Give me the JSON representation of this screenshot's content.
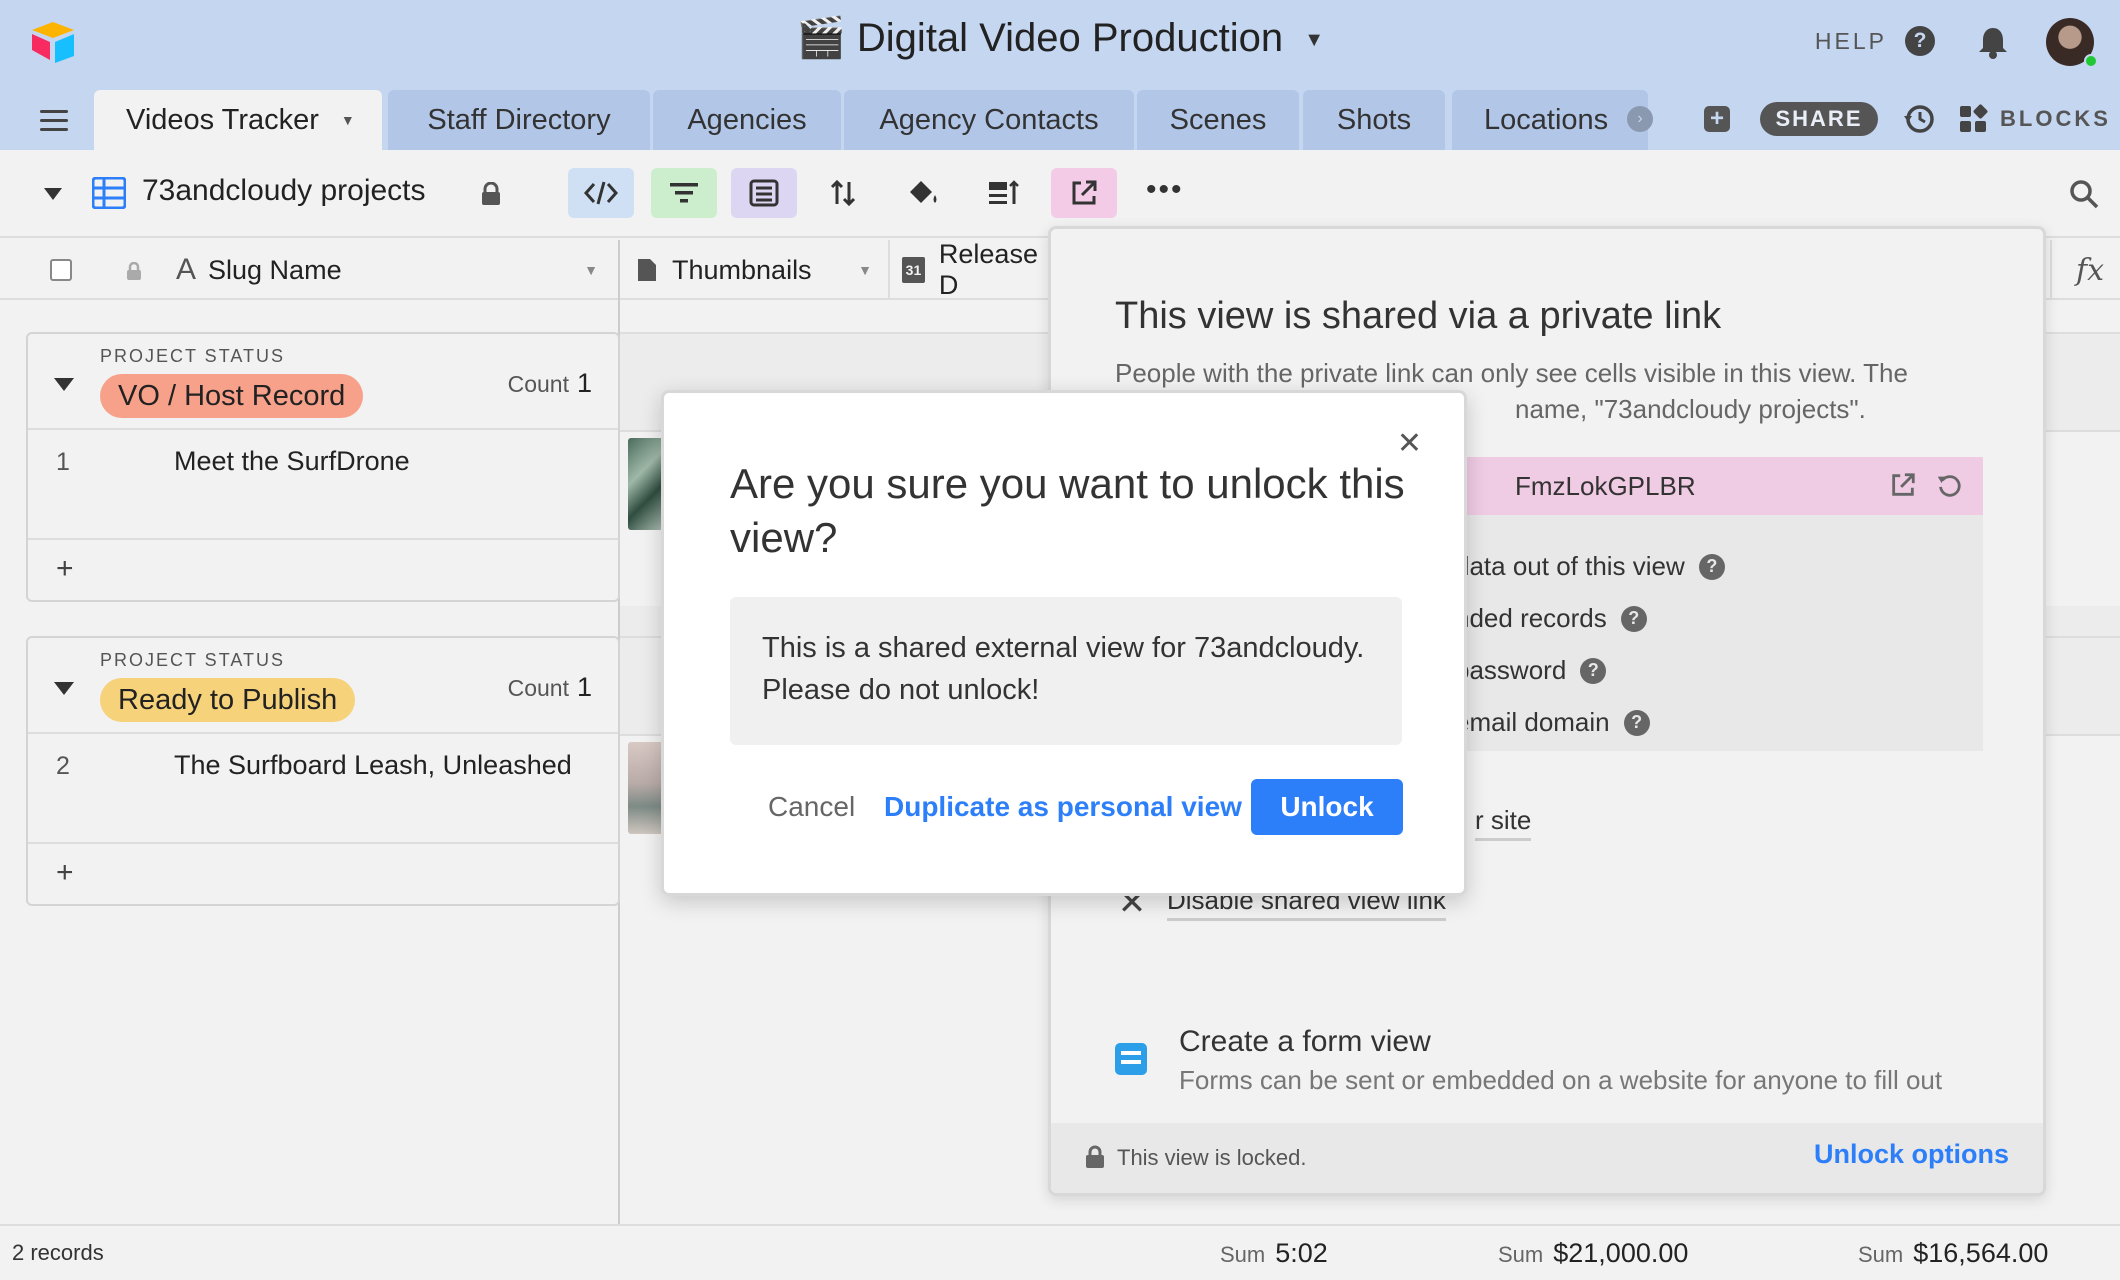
{
  "topbar": {
    "base_title": "Digital Video Production",
    "base_emoji": "🎬",
    "help_label": "HELP",
    "share_label": "SHARE",
    "blocks_label": "BLOCKS"
  },
  "tabs": [
    {
      "label": "Videos Tracker"
    },
    {
      "label": "Staff Directory"
    },
    {
      "label": "Agencies"
    },
    {
      "label": "Agency Contacts"
    },
    {
      "label": "Scenes"
    },
    {
      "label": "Shots"
    },
    {
      "label": "Locations"
    }
  ],
  "viewbar": {
    "view_name": "73andcloudy projects"
  },
  "columns": {
    "slug": "Slug Name",
    "thumbnails": "Thumbnails",
    "release": "Release D",
    "calendar_day": "31"
  },
  "groups": [
    {
      "label": "PROJECT STATUS",
      "status": "VO / Host Record",
      "status_color": "#f7a18a",
      "count_label": "Count",
      "count": "1",
      "rows": [
        {
          "num": "1",
          "name": "Meet the SurfDrone"
        }
      ]
    },
    {
      "label": "PROJECT STATUS",
      "status": "Ready to Publish",
      "status_color": "#f6d27a",
      "count_label": "Count",
      "count": "1",
      "rows": [
        {
          "num": "2",
          "name": "The Surfboard Leash, Unleashed"
        }
      ]
    }
  ],
  "footer": {
    "records": "2 records",
    "sum_label": "Sum",
    "sum1": "5:02",
    "sum2": "$21,000.00",
    "sum3": "$16,564.00"
  },
  "share_panel": {
    "title": "This view is shared via a private link",
    "desc_line1": "People with the private link can only see cells visible in this view. The",
    "desc_line2": "name, \"73andcloudy projects\".",
    "link_text": "FmzLokGPLBR",
    "options": [
      "data out of this view",
      "nded records",
      "password",
      "email domain"
    ],
    "site_text": "r site",
    "disable_text": "Disable shared view link",
    "form_title": "Create a form view",
    "form_desc": "Forms can be sent or embedded on a website for anyone to fill out",
    "locked_text": "This view is locked.",
    "unlock_options": "Unlock options"
  },
  "modal": {
    "title": "Are you sure you want to unlock this view?",
    "message": "This is a shared external view for 73andcloudy. Please do not unlock!",
    "cancel": "Cancel",
    "duplicate": "Duplicate as personal view",
    "unlock": "Unlock"
  },
  "colors": {
    "accent": "#2d7ff9",
    "topbar": "#c5d6f1"
  }
}
